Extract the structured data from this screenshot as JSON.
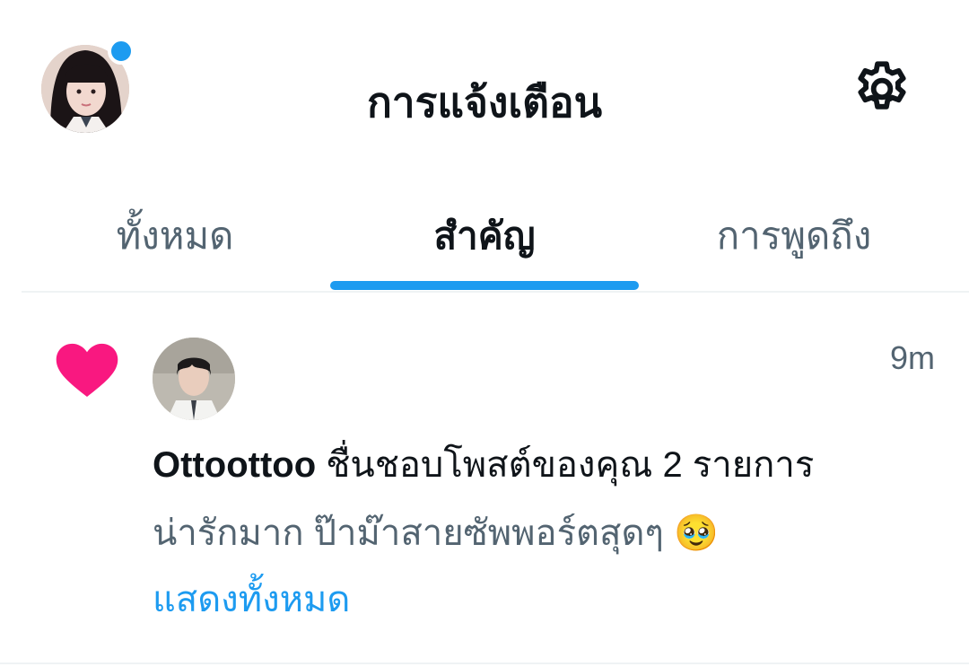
{
  "header": {
    "title": "การแจ้งเตือน",
    "avatar_icon": "profile-avatar",
    "settings_icon": "gear-icon",
    "has_unread_dot": true
  },
  "tabs": [
    {
      "label": "ทั้งหมด",
      "active": false
    },
    {
      "label": "สำคัญ",
      "active": true
    },
    {
      "label": "การพูดถึง",
      "active": false
    }
  ],
  "notification": {
    "type_icon": "heart-icon",
    "timestamp": "9m",
    "username": "Ottoottoo",
    "action_text": "ชื่นชอบโพสต์ของคุณ 2 รายการ",
    "preview_text": "น่ารักมาก ป๊าม๊าสายซัพพอร์ตสุดๆ",
    "preview_emoji": "🥹",
    "show_all_label": "แสดงทั้งหมด"
  },
  "colors": {
    "accent": "#1d9bf0",
    "heart": "#f91880",
    "text_primary": "#0f1419",
    "text_secondary": "#536471"
  }
}
